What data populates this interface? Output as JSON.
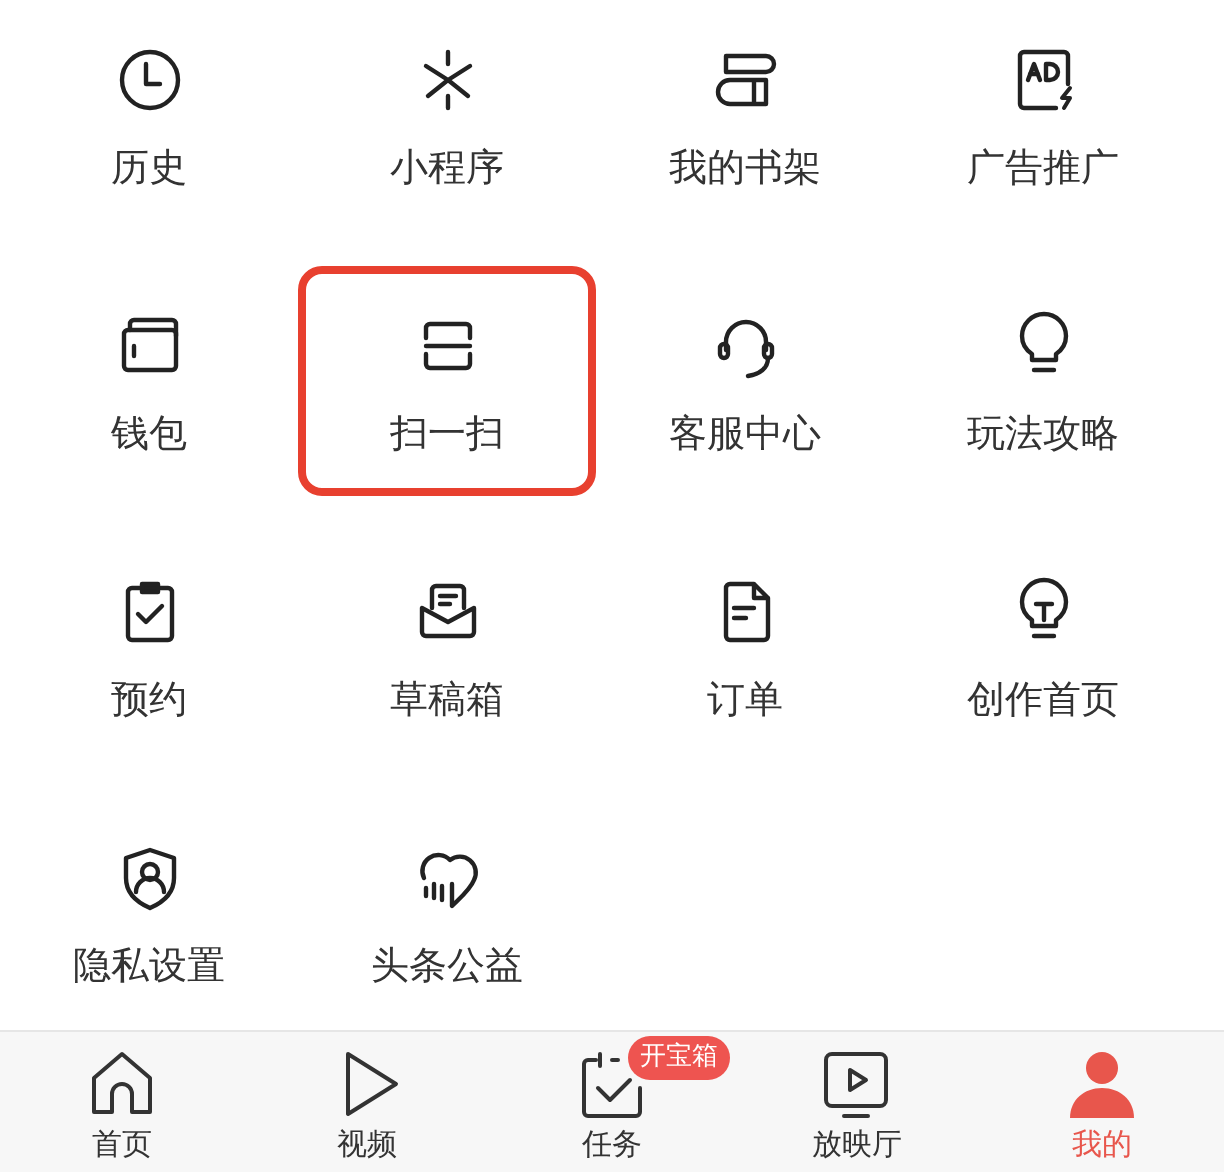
{
  "menu_items": [
    {
      "label": "历史",
      "highlighted": false
    },
    {
      "label": "小程序",
      "highlighted": false
    },
    {
      "label": "我的书架",
      "highlighted": false
    },
    {
      "label": "广告推广",
      "highlighted": false
    },
    {
      "label": "钱包",
      "highlighted": false
    },
    {
      "label": "扫一扫",
      "highlighted": true
    },
    {
      "label": "客服中心",
      "highlighted": false
    },
    {
      "label": "玩法攻略",
      "highlighted": false
    },
    {
      "label": "预约",
      "highlighted": false
    },
    {
      "label": "草稿箱",
      "highlighted": false
    },
    {
      "label": "订单",
      "highlighted": false
    },
    {
      "label": "创作首页",
      "highlighted": false
    },
    {
      "label": "隐私设置",
      "highlighted": false
    },
    {
      "label": "头条公益",
      "highlighted": false
    }
  ],
  "tab_bar": [
    {
      "label": "首页",
      "selected": false
    },
    {
      "label": "视频",
      "selected": false
    },
    {
      "label": "任务",
      "selected": false,
      "badge": "开宝箱"
    },
    {
      "label": "放映厅",
      "selected": false
    },
    {
      "label": "我的",
      "selected": true
    }
  ]
}
